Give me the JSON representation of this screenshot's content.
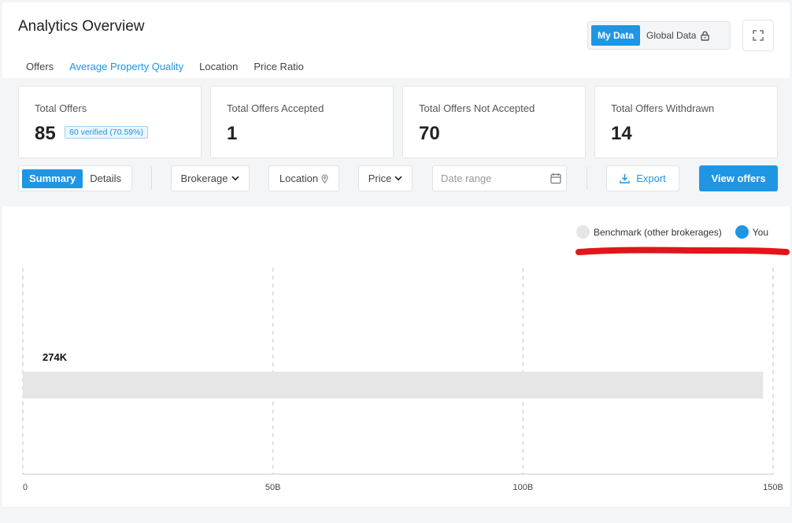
{
  "header": {
    "title": "Analytics Overview",
    "tabs": [
      {
        "label": "Offers",
        "active": false
      },
      {
        "label": "Average Property Quality",
        "active": true
      },
      {
        "label": "Location",
        "active": false
      },
      {
        "label": "Price Ratio",
        "active": false
      }
    ],
    "toggle": {
      "my_data": "My Data",
      "global_data": "Global Data"
    }
  },
  "stats": [
    {
      "label": "Total Offers",
      "value": "85",
      "badge": "60 verified (70.59%)"
    },
    {
      "label": "Total Offers Accepted",
      "value": "1"
    },
    {
      "label": "Total Offers Not Accepted",
      "value": "70"
    },
    {
      "label": "Total Offers Withdrawn",
      "value": "14"
    }
  ],
  "filters": {
    "summary": "Summary",
    "details": "Details",
    "brokerage": "Brokerage",
    "location": "Location",
    "price": "Price",
    "date_placeholder": "Date range",
    "export": "Export",
    "view_offers": "View offers"
  },
  "colors": {
    "accent": "#1e96e3",
    "benchmark": "#e6e6e6",
    "you": "#1e96e3",
    "annotation": "#e0161b"
  },
  "chart_data": {
    "type": "bar",
    "orientation": "horizontal",
    "legend": [
      "Benchmark (other brokerages)",
      "You"
    ],
    "legend_position": "top-right",
    "grid": true,
    "xlim": [
      0,
      150000000000
    ],
    "xticks": [
      {
        "value": 0,
        "label": "0"
      },
      {
        "value": 50000000000,
        "label": "50B"
      },
      {
        "value": 100000000000,
        "label": "100B"
      },
      {
        "value": 150000000000,
        "label": "150B"
      }
    ],
    "series": [
      {
        "name": "Benchmark (other brokerages)",
        "values": [
          148000000000
        ],
        "color": "#e6e6e6"
      },
      {
        "name": "You",
        "values": [
          274000
        ],
        "color": "#1e96e3"
      }
    ],
    "data_labels": [
      "274K"
    ]
  }
}
